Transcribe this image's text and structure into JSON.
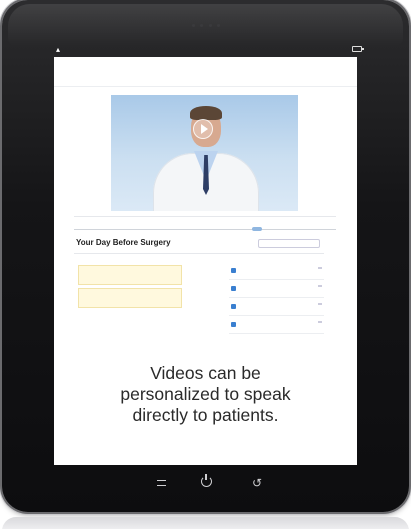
{
  "app": {
    "brand": "",
    "header_links": "",
    "video_title": "",
    "video_caption": ""
  },
  "tabs": [
    {
      "label": "",
      "selected": true
    },
    {
      "label": "",
      "selected": false
    },
    {
      "label": "",
      "selected": false
    }
  ],
  "procedure": {
    "title": "Your Day Before Surgery",
    "language_select": ""
  },
  "notes": [
    "",
    ""
  ],
  "bullet_text": "",
  "resources": [
    {
      "label": "",
      "badge": "",
      "icon": "document-icon",
      "color": "#3a7fd0"
    },
    {
      "label": "",
      "badge": "",
      "icon": "video-icon",
      "color": "#3a7fd0"
    },
    {
      "label": "",
      "badge": "",
      "icon": "mail-icon",
      "color": "#3a7fd0"
    },
    {
      "label": "",
      "badge": "",
      "icon": "pencil-icon",
      "color": "#3a7fd0"
    }
  ],
  "overlay_message": {
    "line1": "Videos can be",
    "line2": "personalized to speak",
    "line3": "directly to patients."
  },
  "colors": {
    "device_body": "#151517",
    "video_background": "#bcd6ef",
    "note_background": "#fff9de"
  }
}
